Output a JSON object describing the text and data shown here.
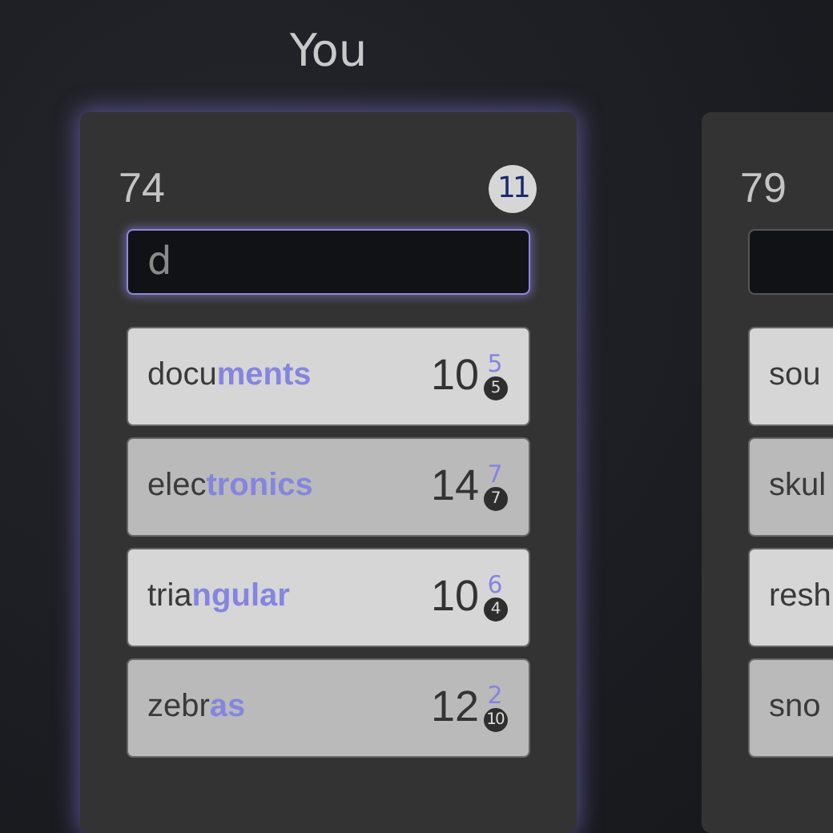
{
  "players": [
    {
      "name": "You",
      "score": "74",
      "badge": "11",
      "input": {
        "value": "d",
        "focused": true
      },
      "words": [
        {
          "prefix": "docu",
          "highlight": "ments",
          "points": "10",
          "bonus": "5",
          "count": "5"
        },
        {
          "prefix": "elec",
          "highlight": "tronics",
          "points": "14",
          "bonus": "7",
          "count": "7"
        },
        {
          "prefix": "tria",
          "highlight": "ngular",
          "points": "10",
          "bonus": "6",
          "count": "4"
        },
        {
          "prefix": "zebr",
          "highlight": "as",
          "points": "12",
          "bonus": "2",
          "count": "10"
        }
      ]
    },
    {
      "score": "79",
      "input": {
        "focused": false
      },
      "words": [
        {
          "prefix": "sou"
        },
        {
          "prefix": "skul"
        },
        {
          "prefix": "resh"
        },
        {
          "prefix": "sno"
        }
      ]
    }
  ]
}
